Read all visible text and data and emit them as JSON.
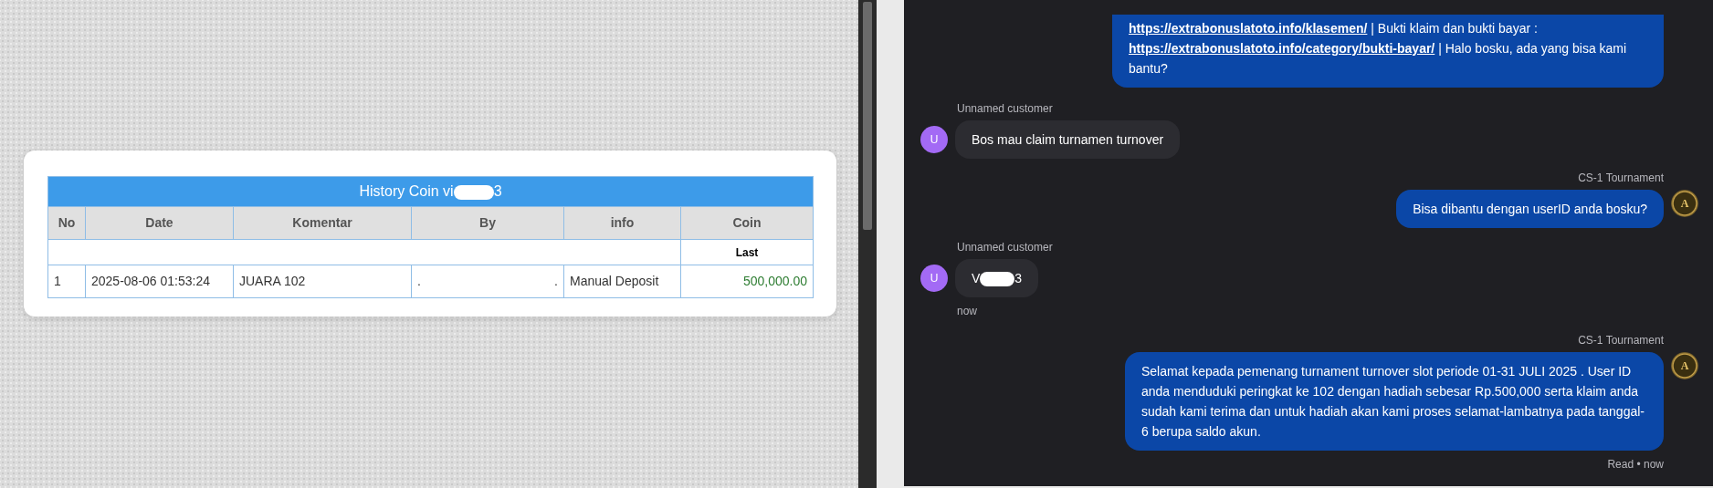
{
  "history_table": {
    "title_parts": [
      "History Coin vi",
      "3"
    ],
    "columns": [
      "No",
      "Date",
      "Komentar",
      "By",
      "info",
      "Coin"
    ],
    "subheader": "Last",
    "rows": [
      {
        "no": "1",
        "date": "2025-08-06 01:53:24",
        "komentar": "JUARA 102",
        "by": [
          ".",
          "."
        ],
        "info": "Manual Deposit",
        "coin": "500,000.00"
      }
    ]
  },
  "chat": {
    "messages": [
      {
        "kind": "agent",
        "segments": [
          {
            "kind": "link",
            "text": "https://extrabonuslatoto.info/klasemen/"
          },
          {
            "kind": "text",
            "text": " | Bukti klaim dan bukti bayar :"
          },
          {
            "kind": "break"
          },
          {
            "kind": "link",
            "text": "https://extrabonuslatoto.info/category/bukti-bayar/"
          },
          {
            "kind": "text",
            "text": " | Halo bosku, ada yang bisa kami bantu?"
          }
        ]
      },
      {
        "kind": "customer",
        "sender": "Unnamed customer",
        "avatar": "U",
        "segments": [
          {
            "kind": "text",
            "text": "Bos mau claim turnamen turnover"
          }
        ]
      },
      {
        "kind": "agent",
        "sender": "CS-1 Tournament",
        "avatar": "A",
        "segments": [
          {
            "kind": "text",
            "text": "Bisa dibantu dengan userID anda bosku?"
          }
        ]
      },
      {
        "kind": "customer",
        "sender": "Unnamed customer",
        "avatar": "U",
        "segments": [
          {
            "kind": "text",
            "text": "V"
          },
          {
            "kind": "redacted"
          },
          {
            "kind": "text",
            "text": "3"
          }
        ],
        "time": "now"
      },
      {
        "kind": "agent",
        "sender": "CS-1 Tournament",
        "avatar": "A",
        "segments": [
          {
            "kind": "text",
            "text": "Selamat kepada pemenang turnament turnover slot periode 01-31 JULI 2025 . User ID anda menduduki peringkat ke 102 dengan hadiah sebesar Rp.500,000 serta klaim anda sudah kami terima dan untuk hadiah akan kami proses selamat-lambatnya pada tanggal-6 berupa saldo akun."
          }
        ],
        "status": "Read • now"
      }
    ]
  }
}
